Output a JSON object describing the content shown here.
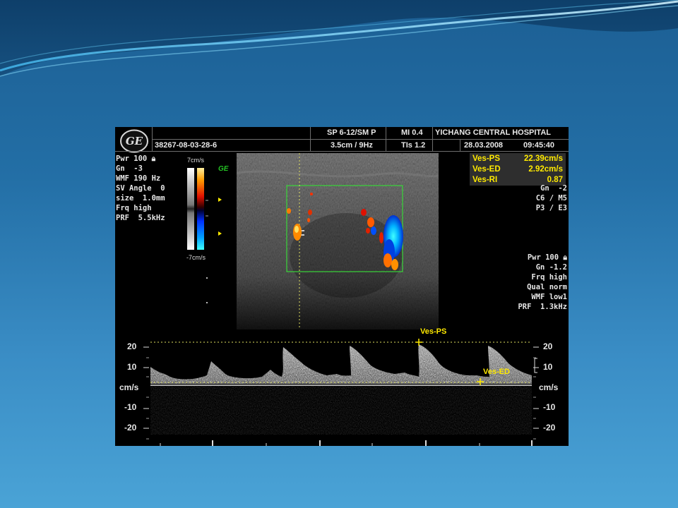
{
  "header": {
    "sp_label": "SP 6-12/SM P",
    "mi_label": "MI  0.4",
    "hospital": "YICHANG CENTRAL HOSPITAL",
    "patient_id": "38267-08-03-28-6",
    "depth_freq": "3.5cm / 9Hz",
    "tis_label": "TIs  1.2",
    "date": "28.03.2008",
    "time": "09:45:40"
  },
  "logo": {
    "brand_letters": "GE"
  },
  "left_params": [
    "Pwr 100",
    "Gn  -3",
    "WMF 190 Hz",
    "SV Angle  0",
    "size  1.0mm",
    "Frq high",
    "PRF  5.5kHz"
  ],
  "color_bar": {
    "top_label": "7cm/s",
    "bottom_label": "-7cm/s",
    "badge": "GE"
  },
  "measurements": [
    {
      "label": "Ves-PS",
      "value": "22.39cm/s"
    },
    {
      "label": "Ves-ED",
      "value": "2.92cm/s"
    },
    {
      "label": "Ves-RI",
      "value": "0.87"
    }
  ],
  "right_params_top": [
    "Gn  -2",
    "C6 / M5",
    "P3 / E3"
  ],
  "right_params_bottom": [
    "Pwr 100",
    "Gn -1.2",
    "Frq high",
    "Qual norm",
    "WMF low1",
    "PRF  1.3kHz"
  ],
  "spectral": {
    "left_ticks": [
      "20",
      "10",
      "cm/s",
      "-10",
      "-20"
    ],
    "right_ticks": [
      "20",
      "10",
      "cm/s",
      "-10",
      "-20"
    ],
    "marker_ps": "Ves-PS",
    "marker_ed": "Ves-ED"
  },
  "colors": {
    "slide_bg": "#236fa6",
    "measure_text": "#ffea00",
    "doppler_box": "#39d639"
  }
}
